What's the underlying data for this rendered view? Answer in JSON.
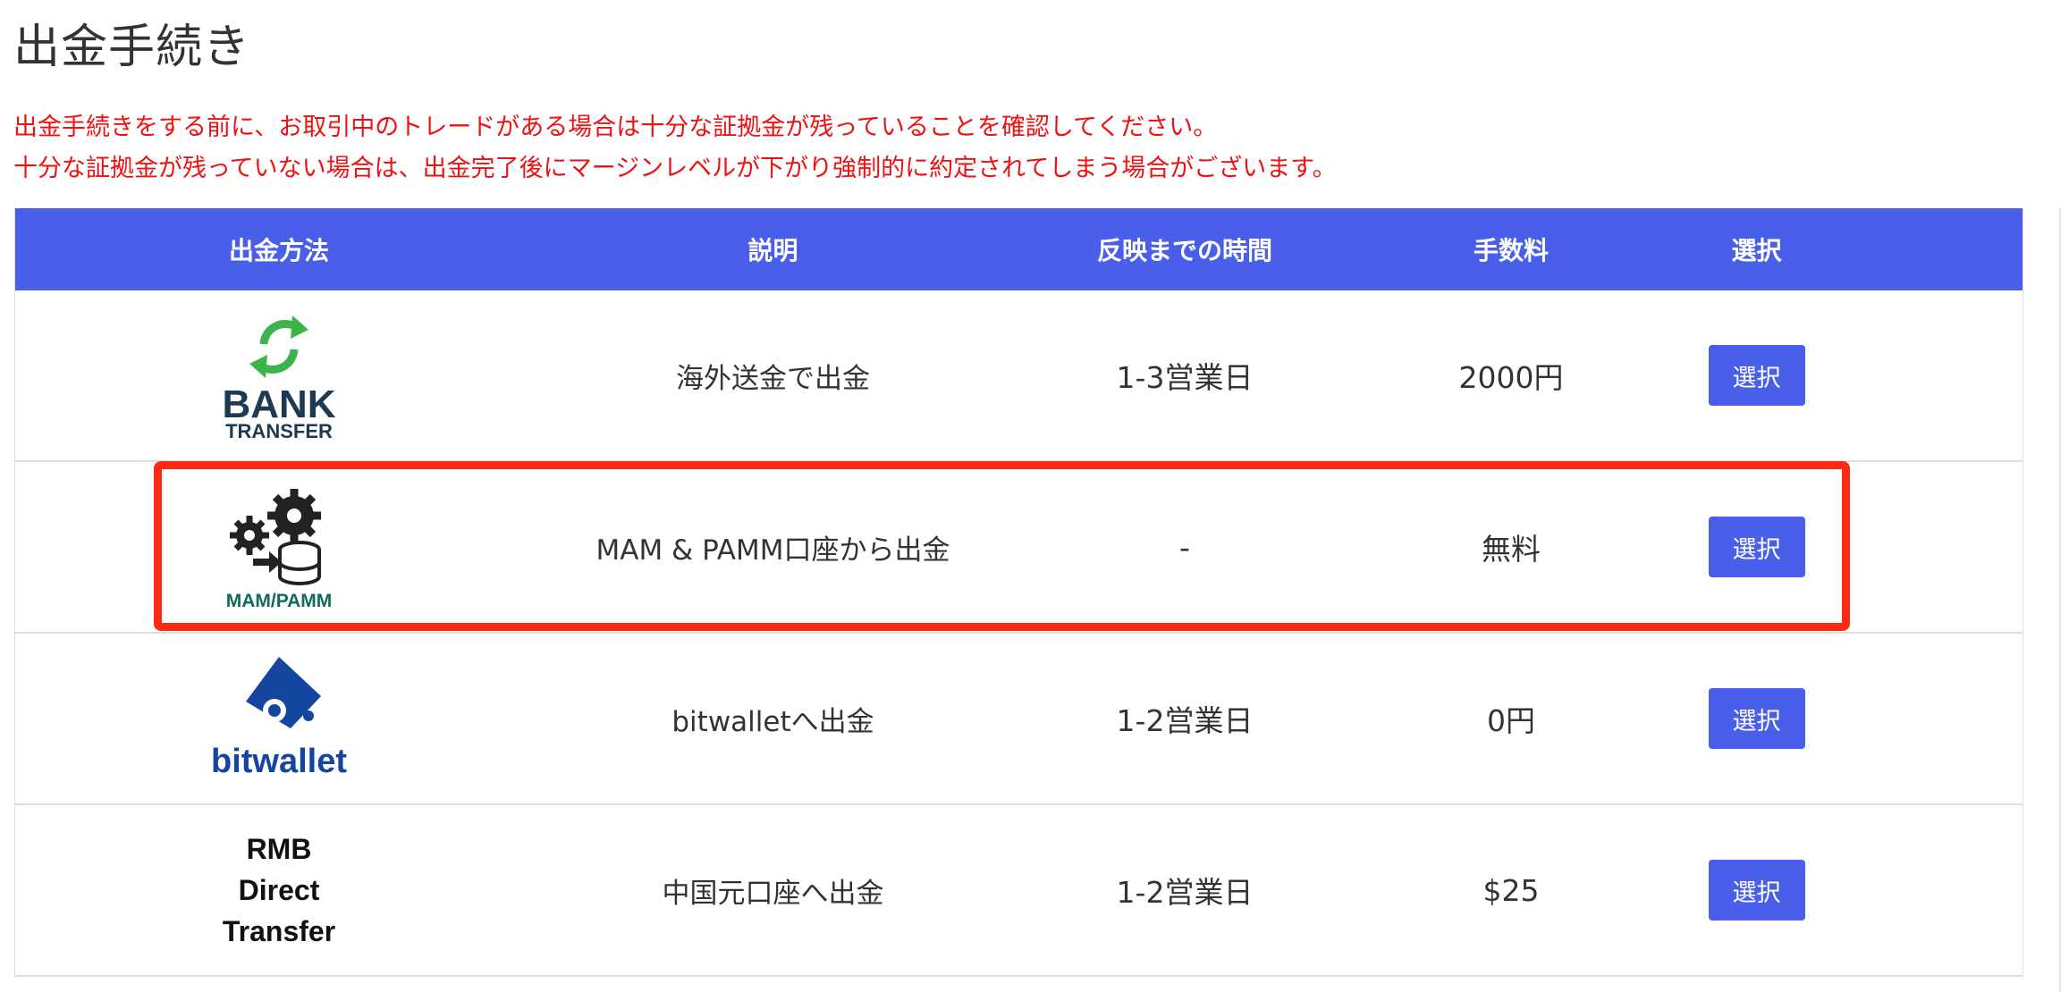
{
  "page": {
    "title": "出金手続き",
    "notice_line1": "出金手続きをする前に、お取引中のトレードがある場合は十分な証拠金が残っていることを確認してください。",
    "notice_line2": "十分な証拠金が残っていない場合は、出金完了後にマージンレベルが下がり強制的に約定されてしまう場合がございます。"
  },
  "colors": {
    "header_bg": "#4a5fe9",
    "button_bg": "#4a5fe9",
    "notice_text": "#ee1111",
    "highlight_border": "#ff2a12"
  },
  "table": {
    "headers": [
      "出金方法",
      "説明",
      "反映までの時間",
      "手数料",
      "選択"
    ],
    "rows": [
      {
        "logo": "bank-transfer-logo",
        "logo_text_1": "BANK",
        "logo_text_2": "TRANSFER",
        "description": "海外送金で出金",
        "time": "1-3営業日",
        "fee": "2000円",
        "button": "選択"
      },
      {
        "logo": "mam-pamm-logo",
        "logo_text_1": "MAM/PAMM",
        "description": "MAM & PAMM口座から出金",
        "time": "-",
        "fee": "無料",
        "button": "選択",
        "highlighted": true
      },
      {
        "logo": "bitwallet-logo",
        "logo_text_1": "bitwallet",
        "description": "bitwalletへ出金",
        "time": "1-2営業日",
        "fee": "0円",
        "button": "選択"
      },
      {
        "logo": "rmb-direct-transfer-text",
        "logo_text_1": "RMB",
        "logo_text_2": "Direct",
        "logo_text_3": "Transfer",
        "description": "中国元口座へ出金",
        "time": "1-2営業日",
        "fee": "$25",
        "button": "選択"
      }
    ]
  }
}
